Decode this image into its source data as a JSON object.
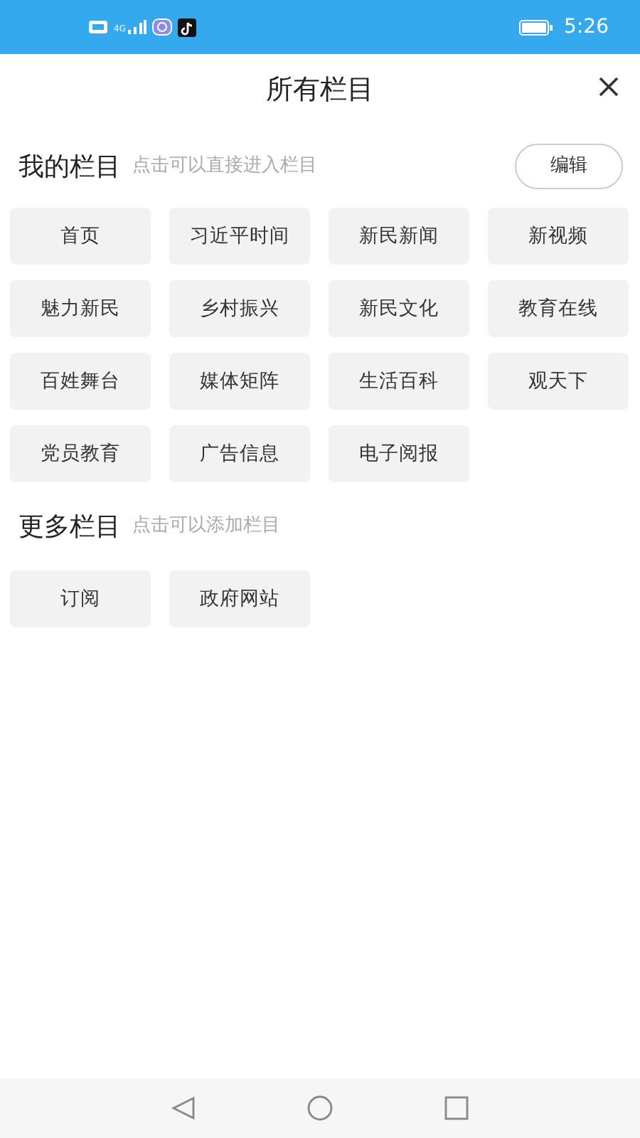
{
  "status_bar": {
    "time": "5:26",
    "network": "4G"
  },
  "header": {
    "title": "所有栏目"
  },
  "sections": [
    {
      "title": "我的栏目",
      "hint": "点击可以直接进入栏目",
      "action": "编辑",
      "items": [
        "首页",
        "习近平时间",
        "新民新闻",
        "新视频",
        "魅力新民",
        "乡村振兴",
        "新民文化",
        "教育在线",
        "百姓舞台",
        "媒体矩阵",
        "生活百科",
        "观天下",
        "党员教育",
        "广告信息",
        "电子阅报"
      ]
    },
    {
      "title": "更多栏目",
      "hint": "点击可以添加栏目",
      "items": [
        "订阅",
        "政府网站"
      ]
    }
  ]
}
